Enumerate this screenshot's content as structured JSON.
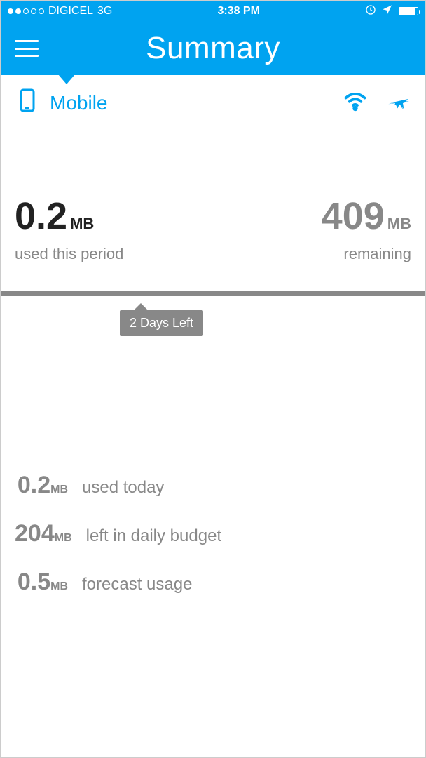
{
  "status": {
    "carrier": "DIGICEL",
    "network": "3G",
    "time": "3:38 PM"
  },
  "header": {
    "title": "Summary"
  },
  "tabs": {
    "mobile_label": "Mobile"
  },
  "usage": {
    "used_value": "0.2",
    "used_unit": "MB",
    "used_label": "used this period",
    "remaining_value": "409",
    "remaining_unit": "MB",
    "remaining_label": "remaining"
  },
  "timeline": {
    "days_left_label": "2 Days Left"
  },
  "stats": {
    "row1": {
      "value": "0.2",
      "unit": "MB",
      "label": "used today"
    },
    "row2": {
      "value": "204",
      "unit": "MB",
      "label": "left in daily budget"
    },
    "row3": {
      "value": "0.5",
      "unit": "MB",
      "label": "forecast usage"
    }
  }
}
